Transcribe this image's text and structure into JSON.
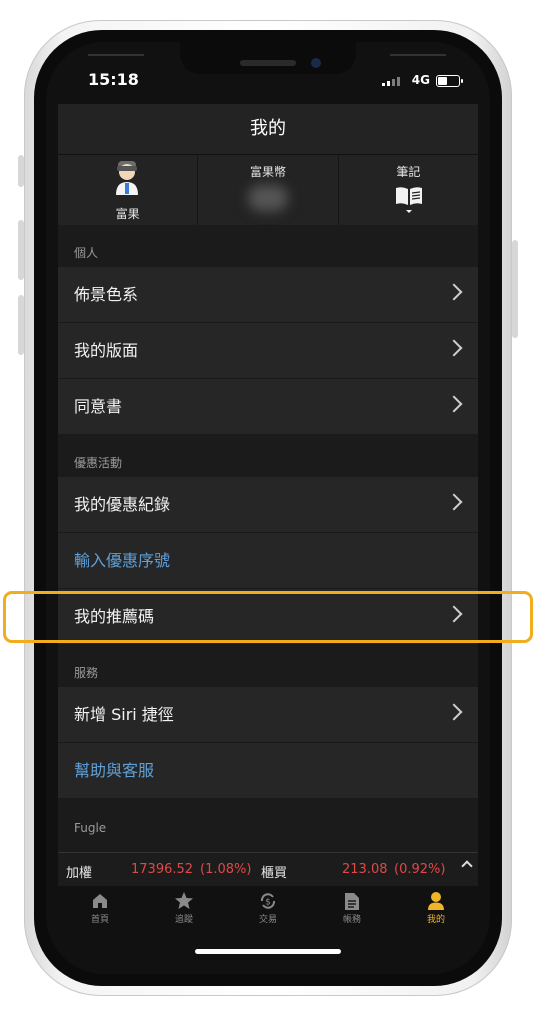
{
  "status_bar": {
    "time": "15:18",
    "network": "4G"
  },
  "nav": {
    "title": "我的"
  },
  "header": {
    "profile_label": "富果",
    "coin_label": "富果幣",
    "notes_label": "筆記"
  },
  "sections": {
    "personal": {
      "label": "個人",
      "items": [
        "佈景色系",
        "我的版面",
        "同意書"
      ]
    },
    "promo": {
      "label": "優惠活動",
      "items": [
        "我的優惠紀錄",
        "輸入優惠序號",
        "我的推薦碼"
      ]
    },
    "service": {
      "label": "服務",
      "items": [
        "新增 Siri 捷徑",
        "幫助與客服"
      ]
    },
    "fugle": {
      "label": "Fugle"
    }
  },
  "ticker": {
    "index1_name": "加權",
    "index1_value": "17396.52",
    "index1_change": "(1.08%)",
    "index2_name": "櫃買",
    "index2_value": "213.08",
    "index2_change": "(0.92%)"
  },
  "tabs": [
    "首頁",
    "追蹤",
    "交易",
    "帳務",
    "我的"
  ],
  "colors": {
    "accent": "#f0b429",
    "link": "#5fa0d8",
    "up": "#e04848",
    "highlight": "#f1ad1d"
  }
}
